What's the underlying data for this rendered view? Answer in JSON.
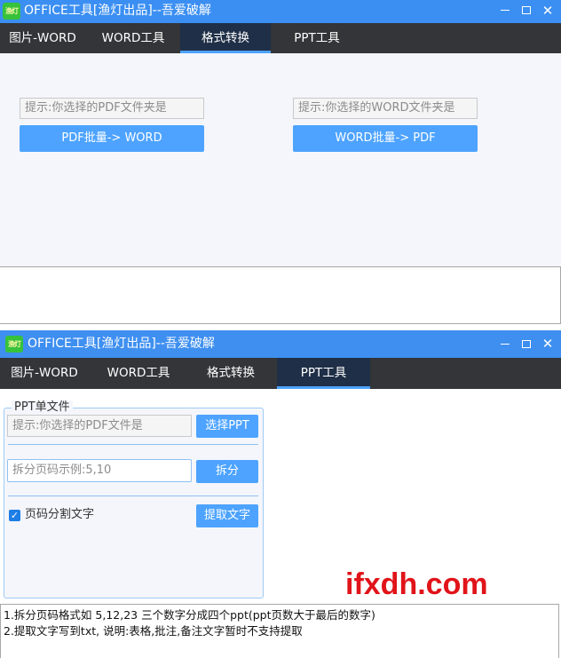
{
  "window_title": "OFFICE工具[渔灯出品]--吾爱破解",
  "logo_text": "渔灯",
  "window_controls": {
    "minimize": "",
    "maximize": "",
    "close": "✕"
  },
  "tabs": [
    "图片-WORD",
    "WORD工具",
    "格式转换",
    "PPT工具"
  ],
  "format_tab": {
    "pdf_folder_placeholder": "提示:你选择的PDF文件夹是",
    "pdf_to_word_button": "PDF批量-> WORD",
    "word_folder_placeholder": "提示:你选择的WORD文件夹是",
    "word_to_pdf_button": "WORD批量-> PDF"
  },
  "ppt_tab": {
    "group_title": "PPT单文件",
    "file_placeholder": "提示:你选择的PDF文件是",
    "select_ppt_button": "选择PPT",
    "page_input_placeholder": "拆分页码示例:5,10",
    "split_button": "拆分",
    "split_text_checkbox_label": "页码分割文字",
    "split_text_checked": true,
    "extract_text_button": "提取文字",
    "notes": [
      "1.拆分页码格式如 5,12,23 三个数字分成四个ppt(ppt页数大于最后的数字)",
      "2.提取文字写到txt, 说明:表格,批注,备注文字暂时不支持提取"
    ]
  },
  "watermark": "ifxdh.com"
}
